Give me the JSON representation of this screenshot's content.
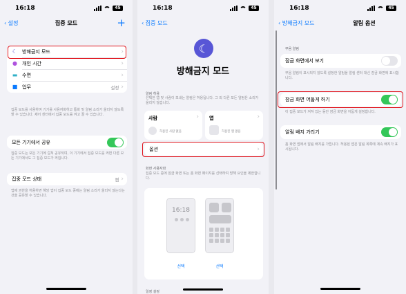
{
  "status": {
    "time": "16:18",
    "battery": "45"
  },
  "screen1": {
    "back": "설정",
    "title": "집중 모드",
    "plus": "+",
    "modes": [
      {
        "label": "방해금지 모드",
        "value": "",
        "icon": "moon-icon",
        "color": "#5856d6"
      },
      {
        "label": "개인 시간",
        "value": "",
        "icon": "person-icon",
        "color": "#af52de"
      },
      {
        "label": "수면",
        "value": "",
        "icon": "bed-icon",
        "color": "#30b0c7"
      },
      {
        "label": "업무",
        "value": "설정",
        "icon": "briefcase-icon",
        "color": "#0a7aff"
      }
    ],
    "modes_note": "집중 모드를 사용하여 기기를 사용자화하고 통화 및 알림 소리가 울리지 않도록 할 수 있습니다. 제어 센터에서 집중 모드를 켜고 끌 수 있습니다.",
    "share_label": "모든 기기에서 공유",
    "share_note": "집중 모드는 모든 기기에 걸쳐 공유되며, 이 기기에서 집중 모드를 켜면 다른 모든 기기에서도 그 집중 모드가 켜집니다.",
    "status_label": "집중 모드 상태",
    "status_value": "켬",
    "status_note": "앱에 권한을 허용하면 해당 앱이 집중 모드 중에는 알림 소리가 울리지 않는다는 것을 공유할 수 있습니다."
  },
  "screen2": {
    "back": "집중 모드",
    "title": "방해금지 모드",
    "allow_section": "알림 허용",
    "allow_note": "선택한 앱 및 사람이 보내는 알림은 허용됩니다. 그 외 다른 모든 알림은 소리가 울리지 않습니다.",
    "people_label": "사람",
    "people_sub": "허용된 사람 없음",
    "apps_label": "앱",
    "apps_sub": "허용된 앱 없음",
    "options_label": "옵션",
    "screen_section": "화면 사용자화",
    "screen_note": "집중 모드 중에 잠금 화면 또는 홈 화면 페이지를 선택하여 방해 요인을 제한합니다.",
    "lock_time": "16:18",
    "select_lock": "선택",
    "select_home": "선택",
    "schedule_section": "일정 설정"
  },
  "screen3": {
    "back": "방해금지 모드",
    "title": "알림 옵션",
    "section": "무음 알림",
    "show_lock_label": "잠금 화면에서 보기",
    "show_lock_note": "무음 알림이 표시되지 않도록 설정한 알림을 알림 센터 대신 잠금 화면에 표시합니다.",
    "show_lock_on": false,
    "dim_label": "잠금 화면 어둡게 하기",
    "dim_note": "이 집중 모드가 켜져 있는 동안 잠금 화면을 어둡게 설정합니다.",
    "dim_on": true,
    "badge_label": "알림 배지 가리기",
    "badge_note": "홈 화면 앱에서 알림 배지를 가립니다. 허용된 앱은 알림 목록에 계속 배지가 표시됩니다.",
    "badge_on": true
  }
}
